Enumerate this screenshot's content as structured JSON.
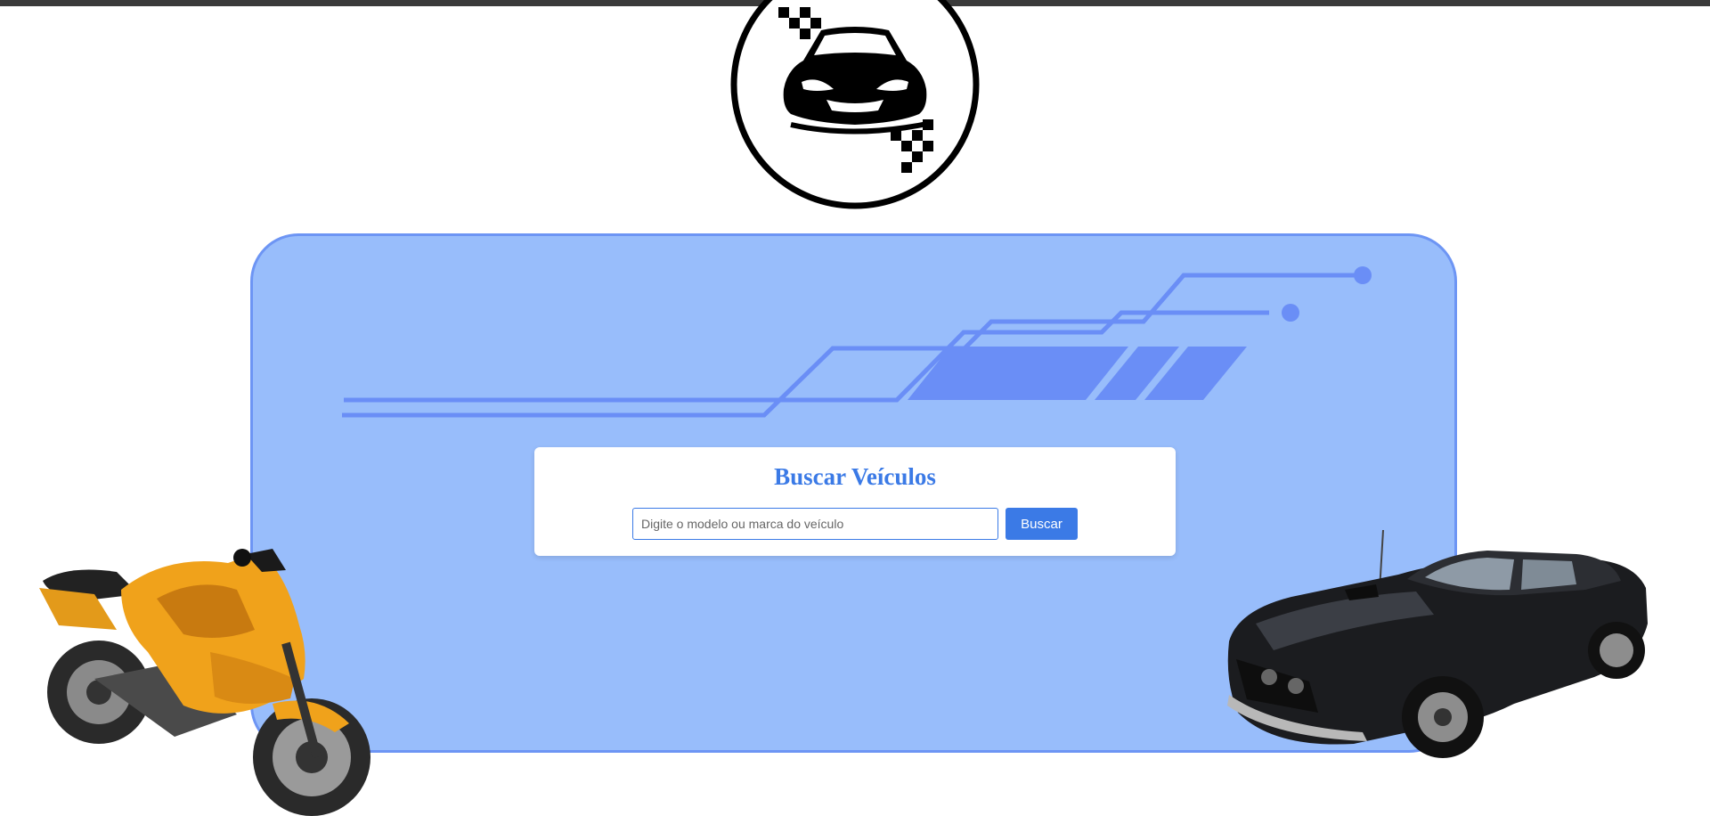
{
  "search": {
    "title": "Buscar Veículos",
    "input_value": "",
    "placeholder": "Digite o modelo ou marca do veículo",
    "button_label": "Buscar"
  },
  "icons": {
    "logo": "race-car-logo-icon",
    "motorcycle": "motorcycle-image",
    "muscle_car": "muscle-car-image",
    "decoration": "speed-lines-decoration"
  },
  "colors": {
    "panel_background": "#98bdfb",
    "panel_border": "#6d95f4",
    "accent": "#3b7ae6",
    "topbar": "#3a3a3a"
  }
}
